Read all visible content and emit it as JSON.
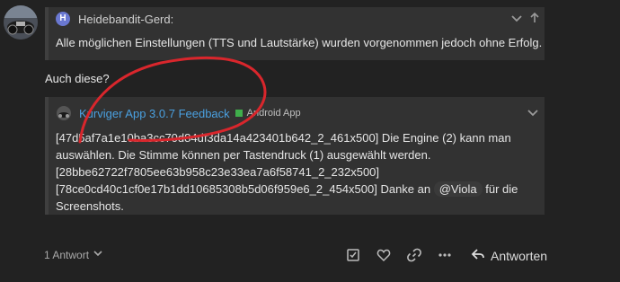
{
  "quote1": {
    "avatar_letter": "H",
    "username": "Heidebandit-Gerd:",
    "text": "Alle möglichen Einstellungen (TTS und Lautstärke) wurden vorgenommen jedoch ohne Erfolg."
  },
  "plain_text": "Auch diese?",
  "quote2": {
    "title": "Kurviger App 3.0.7 Feedback",
    "category": "Android App",
    "category_color": "#3fae4b",
    "line1": "[47d5af7a1e10ba3cc70d84df3da14a423401b642_2_461x500] Die Engine (2) kann man",
    "line2": "auswählen. Die Stimme können per Tastendruck (1) ausgewählt werden.",
    "line3": "[28bbe62722f7805ee63b958c23e33ea7a6f58741_2_232x500]",
    "line4a": "[78ce0cd40c1cf0e17b1dd10685308b5d06f959e6_2_454x500] Danke an",
    "mention": "@Viola",
    "line4b": "für die",
    "line5": "Screenshots."
  },
  "footer": {
    "replies": "1 Antwort",
    "reply_label": "Antworten"
  },
  "colors": {
    "background": "#222222",
    "quote_bg": "#323232",
    "link": "#4aa0e0",
    "annotation_red": "#d9262c"
  },
  "icons": [
    "chevron-down-icon",
    "arrow-up-icon",
    "checkbox-icon",
    "heart-icon",
    "link-icon",
    "more-icon",
    "reply-arrow-icon"
  ]
}
